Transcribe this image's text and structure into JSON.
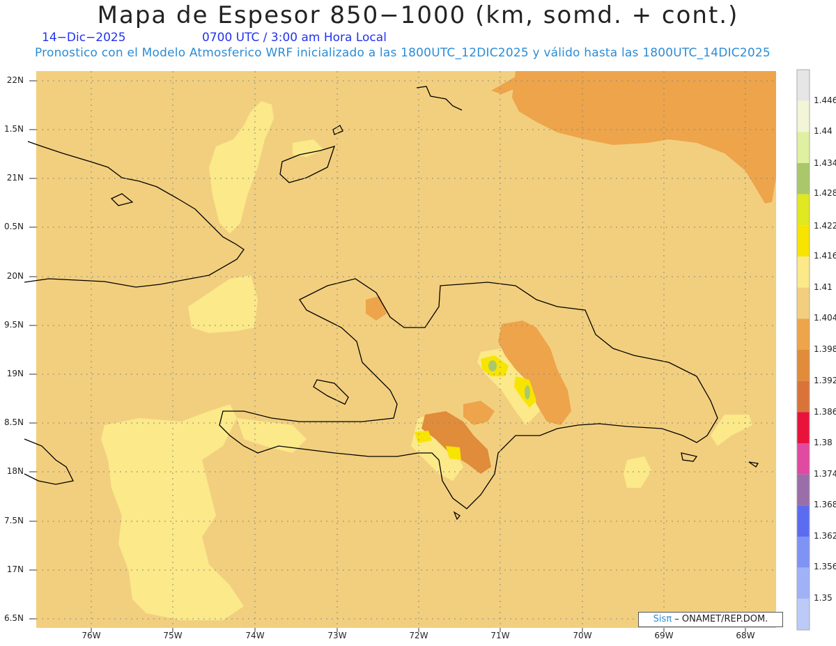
{
  "header": {
    "title": "Mapa de Espesor 850−1000 (km, somd. + cont.)",
    "date": "14−Dic−2025",
    "time": "0700 UTC / 3:00 am Hora Local",
    "subtitle": "Pronostico con el Modelo Atmosferico WRF inicializado a las 1800UTC_12DIC2025 y válido hasta las  1800UTC_14DIC2025"
  },
  "axes": {
    "lat_labels": [
      "22N",
      "1.5N",
      "21N",
      "0.5N",
      "20N",
      "9.5N",
      "19N",
      "8.5N",
      "18N",
      "7.5N",
      "17N",
      "6.5N"
    ],
    "lon_labels": [
      "76W",
      "75W",
      "74W",
      "73W",
      "72W",
      "71W",
      "70W",
      "69W",
      "68W"
    ]
  },
  "colorbar": {
    "labels": [
      "1.446",
      "1.44",
      "1.434",
      "1.428",
      "1.422",
      "1.416",
      "1.41",
      "1.404",
      "1.398",
      "1.392",
      "1.386",
      "1.38",
      "1.374",
      "1.368",
      "1.362",
      "1.356",
      "1.35"
    ],
    "colors": [
      "#e6e6e6",
      "#f2f5d6",
      "#dff0a0",
      "#aac86a",
      "#e0e820",
      "#f7e400",
      "#fbe98a",
      "#f2cf7e",
      "#eda44a",
      "#e08c3a",
      "#d9733a",
      "#e8123a",
      "#e04aa0",
      "#9a6ea8",
      "#5c6cf0",
      "#7f93f5",
      "#9fb2f8",
      "#bccaf8"
    ]
  },
  "credit": {
    "sis": "Sis",
    "pi": "π",
    "rest": "– ONAMET/REP.DOM."
  },
  "colors": {
    "base": "#f2cf7e",
    "light": "#fbe98a",
    "orange": "#eda44a",
    "dark_orange": "#e08c3a",
    "yellow": "#f7e400",
    "green": "#aac86a"
  }
}
